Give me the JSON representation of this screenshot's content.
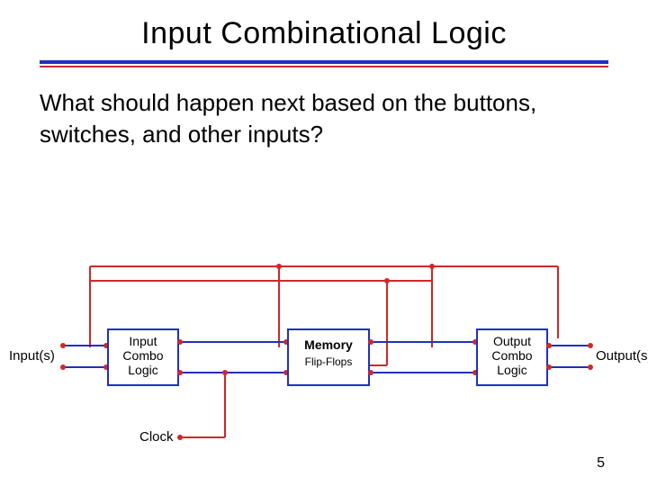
{
  "title": "Input Combinational Logic",
  "body": "What should happen next based on the buttons, switches, and other inputs?",
  "labels": {
    "inputs": "Input(s)",
    "block1_l1": "Input",
    "block1_l2": "Combo",
    "block1_l3": "Logic",
    "block2_l1": "Memory",
    "block2_l2": "Flip-Flops",
    "block3_l1": "Output",
    "block3_l2": "Combo",
    "block3_l3": "Logic",
    "outputs": "Output(s)",
    "clock": "Clock"
  },
  "page": "5"
}
